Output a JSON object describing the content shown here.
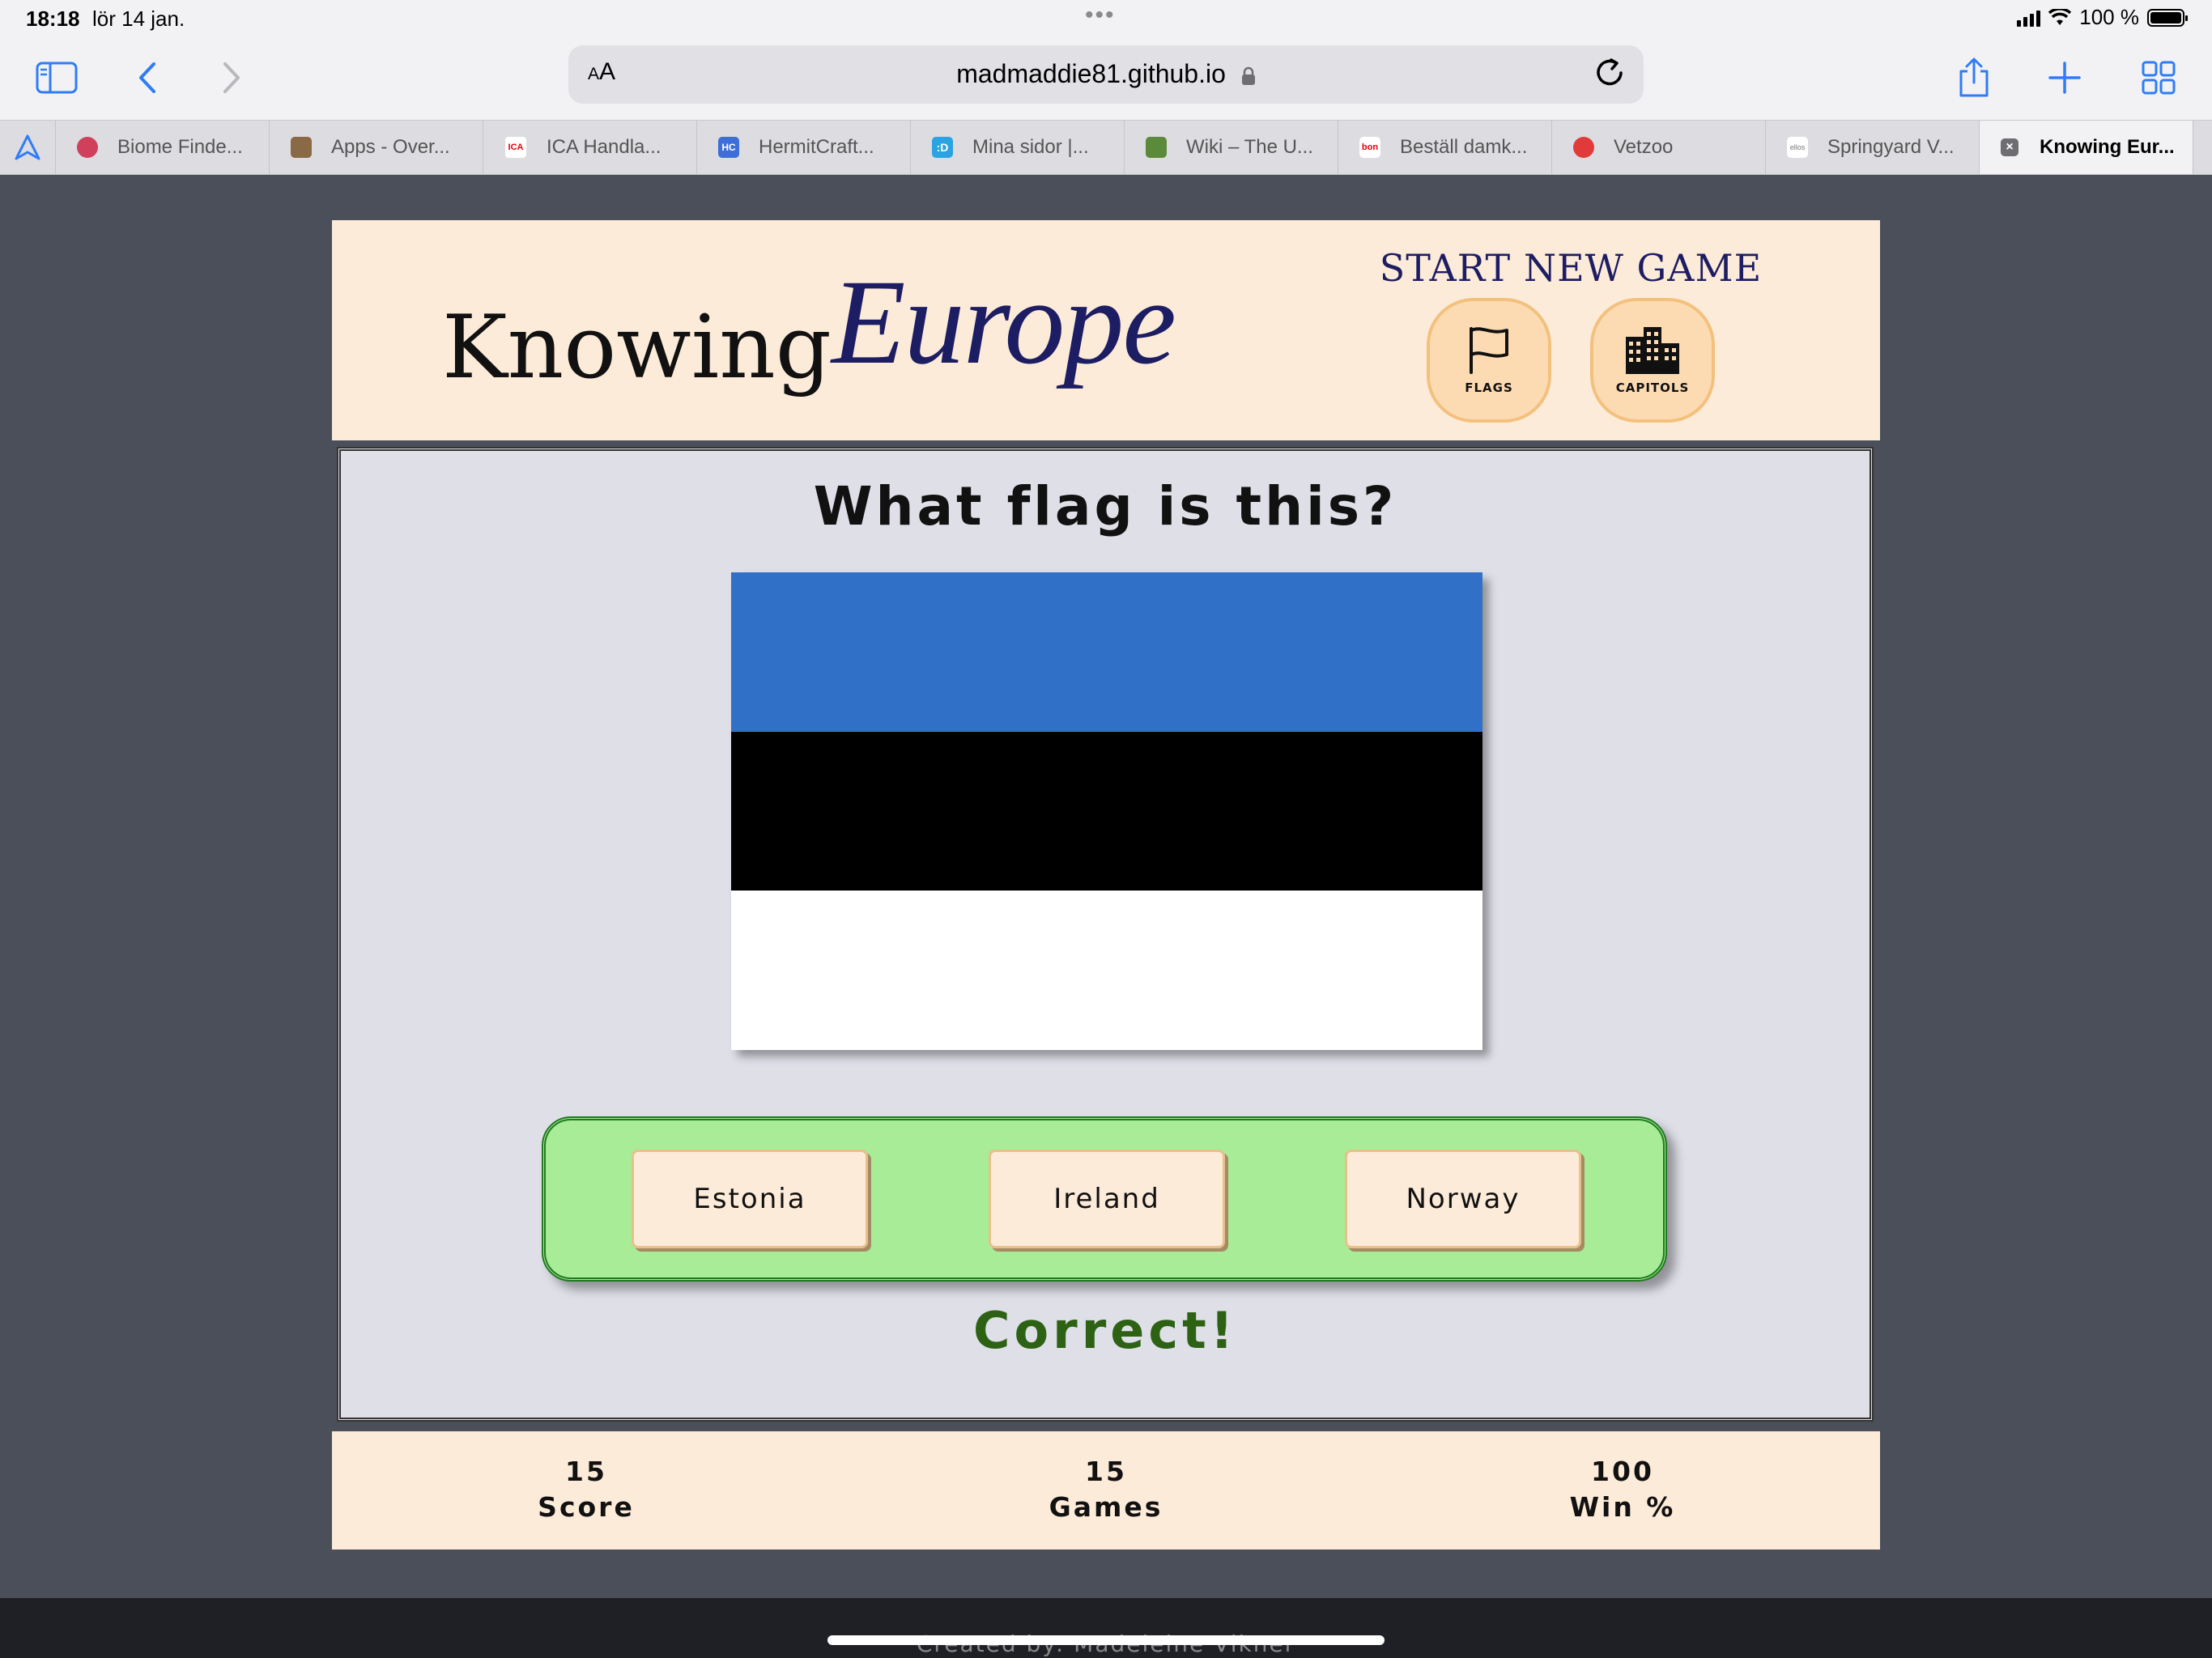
{
  "status_bar": {
    "time": "18:18",
    "date": "lör 14 jan.",
    "dots": "•••",
    "battery_text": "100 %"
  },
  "browser": {
    "aa_label": "AA",
    "url": "madmaddie81.github.io",
    "tabs": [
      {
        "label": "Biome Finde...",
        "favicon_color": "#d0405a"
      },
      {
        "label": "Apps - Over...",
        "favicon_color": "#8a6a44"
      },
      {
        "label": "ICA Handla...",
        "favicon_color": "#e3000b",
        "favicon_text": "ICA"
      },
      {
        "label": "HermitCraft...",
        "favicon_color": "#3d6fd6",
        "favicon_text": "HC"
      },
      {
        "label": "Mina sidor |...",
        "favicon_color": "#2ba3e2",
        "favicon_text": ":D"
      },
      {
        "label": "Wiki – The U...",
        "favicon_color": "#5b8a3a"
      },
      {
        "label": "Beställ damk...",
        "favicon_color": "#e3000b",
        "favicon_text": "bon"
      },
      {
        "label": "Vetzoo",
        "favicon_color": "#e23a3a"
      },
      {
        "label": "Springyard V...",
        "favicon_color": "#777777",
        "favicon_text": "ellos"
      },
      {
        "label": "Knowing Eur...",
        "favicon_color": "#444444",
        "favicon_text": "×"
      }
    ]
  },
  "header": {
    "logo_part1": "Knowing",
    "logo_part2": "Europe",
    "start_title": "START NEW GAME",
    "flags_label": "FLAGS",
    "capitols_label": "CAPITOLS"
  },
  "game": {
    "question": "What flag is this?",
    "flag_colors": [
      "#3071c7",
      "#000000",
      "#ffffff"
    ],
    "answers": [
      "Estonia",
      "Ireland",
      "Norway"
    ],
    "result": "Correct!"
  },
  "stats": {
    "score_value": "15",
    "score_label": "Score",
    "games_value": "15",
    "games_label": "Games",
    "win_value": "100",
    "win_label": "Win %"
  },
  "footer": {
    "text": "Created by: Madeleine Vikner"
  }
}
